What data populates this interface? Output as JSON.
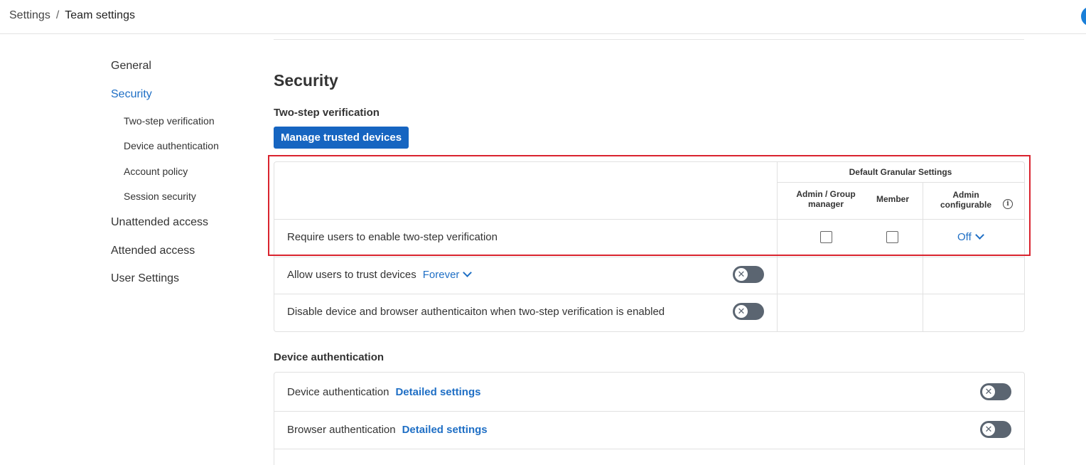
{
  "breadcrumb": {
    "root": "Settings",
    "separator": "/",
    "current": "Team settings"
  },
  "nav": {
    "items": [
      {
        "label": "General",
        "active": false
      },
      {
        "label": "Security",
        "active": true
      },
      {
        "label": "Two-step verification",
        "sub": true
      },
      {
        "label": "Device authentication",
        "sub": true
      },
      {
        "label": "Account policy",
        "sub": true
      },
      {
        "label": "Session security",
        "sub": true
      },
      {
        "label": "Unattended access",
        "active": false
      },
      {
        "label": "Attended access",
        "active": false
      },
      {
        "label": "User Settings",
        "active": false
      }
    ]
  },
  "main": {
    "title": "Security",
    "two_step": {
      "heading": "Two-step verification",
      "manage_button": "Manage trusted devices",
      "table": {
        "group_header": "Default Granular Settings",
        "columns": [
          "Admin / Group manager",
          "Member",
          "Admin configurable"
        ],
        "rows": [
          {
            "label": "Require users to enable two-step verification",
            "admin_checked": false,
            "member_checked": false,
            "admin_configurable": "Off"
          },
          {
            "label": "Allow users to trust devices",
            "value": "Forever",
            "toggle": "off"
          },
          {
            "label": "Disable device and browser authenticaiton when two-step verification is enabled",
            "toggle": "off"
          }
        ]
      }
    },
    "device_auth": {
      "heading": "Device authentication",
      "rows": [
        {
          "label": "Device authentication",
          "link": "Detailed settings",
          "toggle": "off"
        },
        {
          "label": "Browser authentication",
          "link": "Detailed settings",
          "toggle": "off"
        }
      ]
    }
  },
  "icons": {
    "toggle_off": "close-icon",
    "dropdown": "chevron-down-icon",
    "info": "info-icon"
  },
  "colors": {
    "accent": "#1f6fc5",
    "primary_button": "#1665c1",
    "toggle_off": "#5b6571",
    "highlight": "#d9232e"
  }
}
